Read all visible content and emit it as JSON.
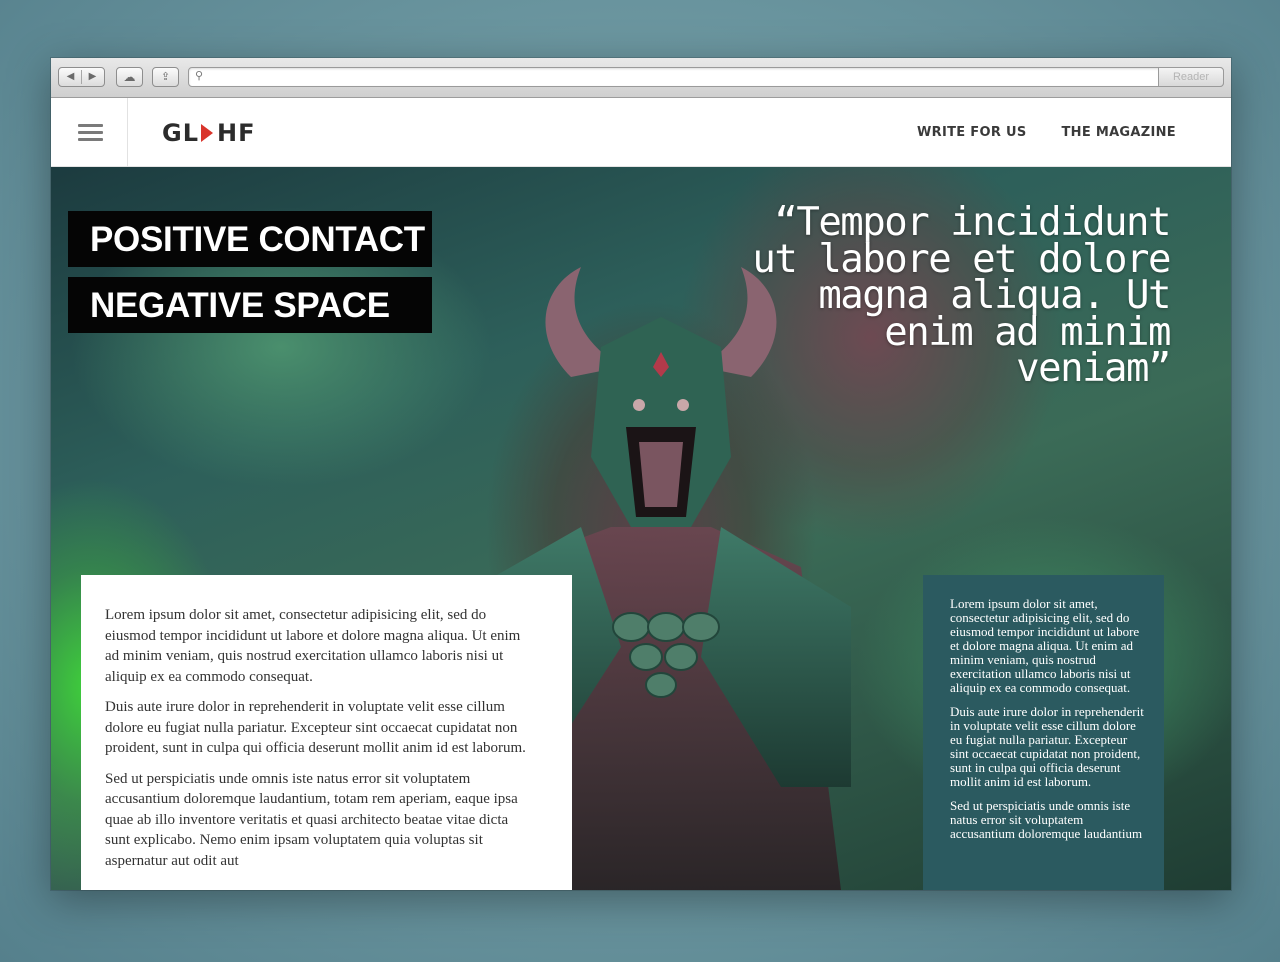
{
  "browser": {
    "back_icon": "◀",
    "forward_icon": "▶",
    "cloud_icon": "☁",
    "share_icon": "⇪",
    "search_icon": "⚲",
    "url": "",
    "reader_label": "Reader"
  },
  "site": {
    "logo_left": "GL",
    "logo_right": "HF",
    "nav": [
      "WRITE FOR US",
      "THE MAGAZINE"
    ],
    "accent_color": "#d9342b"
  },
  "hero": {
    "title_lines": [
      "POSITIVE CONTACT",
      "NEGATIVE SPACE"
    ],
    "quote": "“Tempor incididunt ut labore et dolore magna aliqua. Ut enim ad minim veniam”"
  },
  "article_left": [
    "Lorem ipsum dolor sit amet, consectetur adipisicing elit, sed do eiusmod tempor incididunt ut labore et dolore magna aliqua. Ut enim ad minim veniam, quis nostrud exercitation ullamco laboris nisi ut aliquip ex ea commodo consequat.",
    "Duis aute irure dolor in reprehenderit in voluptate velit esse cillum dolore eu fugiat nulla pariatur. Excepteur sint occaecat cupidatat non proident, sunt in culpa qui officia deserunt mollit anim id est laborum.",
    "Sed ut perspiciatis unde omnis iste natus error sit voluptatem accusantium doloremque laudantium, totam rem aperiam, eaque ipsa quae ab illo inventore veritatis et quasi architecto beatae vitae dicta sunt explicabo. Nemo enim ipsam voluptatem quia voluptas sit aspernatur aut odit aut"
  ],
  "article_right": [
    "Lorem ipsum dolor sit amet, consectetur adipisicing elit, sed do eiusmod tempor incididunt ut labore et dolore magna aliqua. Ut enim ad minim veniam, quis nostrud exercitation ullamco laboris nisi ut aliquip ex ea commodo consequat.",
    "Duis aute irure dolor in reprehenderit in voluptate velit esse cillum dolore eu fugiat nulla pariatur. Excepteur sint occaecat cupidatat non proident, sunt in culpa qui officia deserunt mollit anim id est laborum.",
    "Sed ut perspiciatis unde omnis iste natus error sit voluptatem accusantium doloremque laudantium"
  ]
}
